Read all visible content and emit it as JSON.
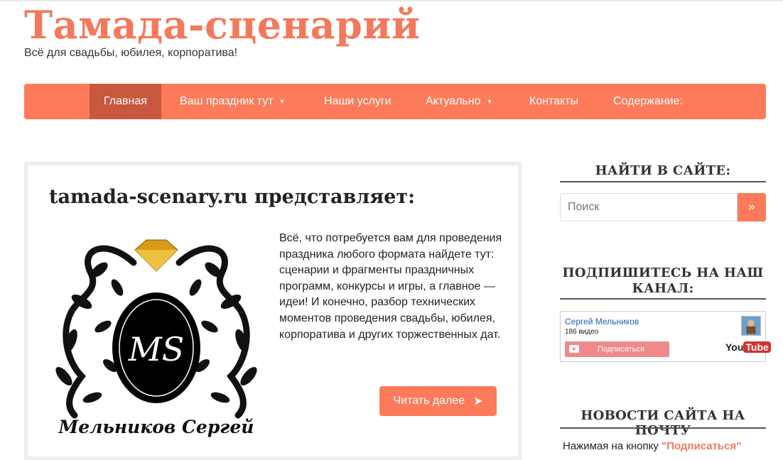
{
  "header": {
    "site_title": "Тамада-сценарий",
    "tagline": "Всё для свадьбы, юбилея, корпоратива!"
  },
  "nav": {
    "items": [
      {
        "label": "Главная",
        "active": true
      },
      {
        "label": "Ваш праздник тут",
        "dropdown": true
      },
      {
        "label": "Наши услуги"
      },
      {
        "label": "Актуально",
        "dropdown": true
      },
      {
        "label": "Контакты"
      },
      {
        "label": "Содержание:"
      }
    ],
    "dropdown_glyph": "»"
  },
  "main": {
    "heading": "tamada-scenary.ru представляет:",
    "text": "Всё, что потребуется вам для проведения праздника любого формата найдете тут: сценарии и фрагменты праздничных программ, конкурсы и игры, а главное — идеи! И конечно, разбор технических моментов проведения свадьбы, юбилея, корпоратива и других торжественных дат.",
    "read_more": "Читать далее",
    "read_more_arrow": "➤",
    "logo": {
      "monogram": "MS",
      "caption": "Мельников Сергей"
    }
  },
  "sidebar": {
    "search": {
      "heading": "НАЙТИ В САЙТЕ:",
      "placeholder": "Поиск",
      "button": "»"
    },
    "subscribe": {
      "heading": "ПОДПИШИТЕСЬ НА НАШ КАНАЛ:",
      "channel_name": "Сергей Мельников",
      "video_count": "186 видео",
      "subscribe_label": "Подписаться",
      "yt_logo_you": "You",
      "yt_logo_tube": "Tube"
    },
    "news": {
      "heading": "НОВОСТИ САЙТА НА ПОЧТУ",
      "text_prefix": "Нажимая на кнопку ",
      "text_highlight": "\"Подписаться\""
    }
  },
  "colors": {
    "accent": "#fd7b5a",
    "title": "#f4795b",
    "nav_active": "#c8583f"
  }
}
